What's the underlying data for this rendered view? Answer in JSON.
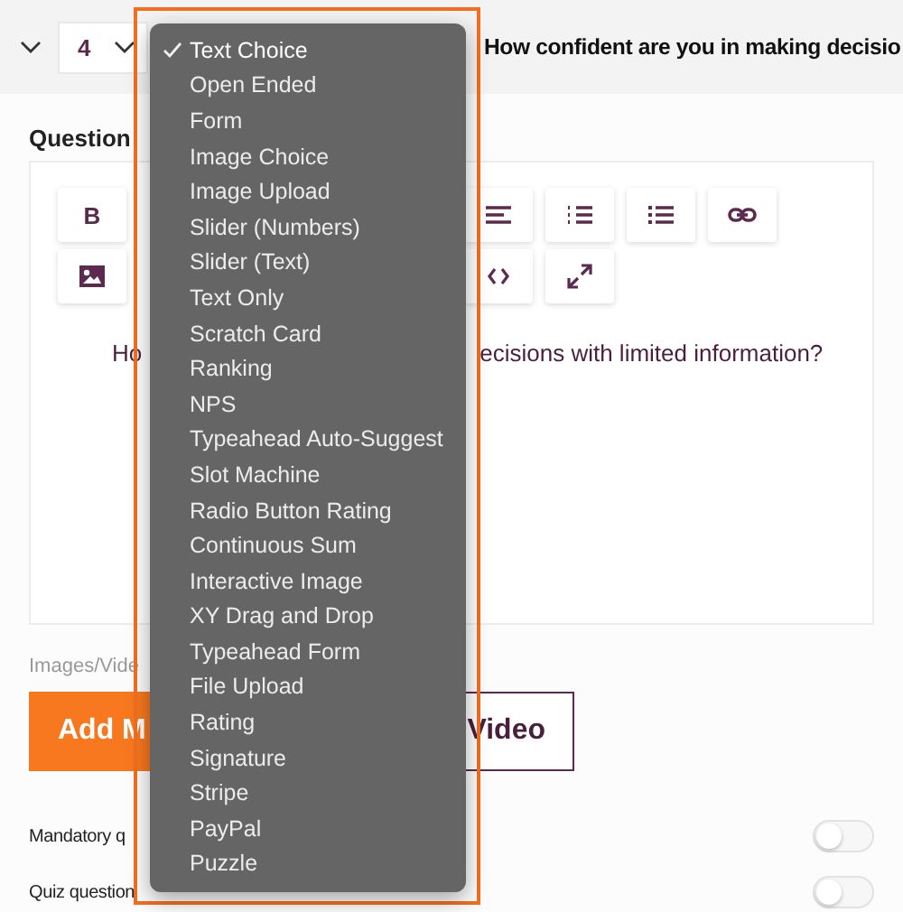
{
  "header": {
    "number": "4",
    "title": "How confident are you in making decisio"
  },
  "question": {
    "label": "Question",
    "toolbar": [
      [
        {
          "kind": "bold",
          "label": "B"
        },
        {
          "kind": "align-left"
        },
        {
          "kind": "ordered-list"
        },
        {
          "kind": "bullet-list"
        },
        {
          "kind": "link"
        }
      ],
      [
        {
          "kind": "image"
        },
        {
          "kind": "code"
        },
        {
          "kind": "expand"
        }
      ]
    ],
    "text_before": "Ho",
    "text_after": "ecisions with limited information?"
  },
  "media": {
    "label": "Images/Vide",
    "buttons": [
      {
        "kind": "primary",
        "label": "Add M"
      },
      {
        "kind": "outline",
        "label": "Video"
      }
    ]
  },
  "settings": [
    {
      "label": "Mandatory q",
      "on": false
    },
    {
      "label": "Quiz question",
      "on": false
    }
  ],
  "type_menu": {
    "items": [
      {
        "label": "Text Choice",
        "selected": true
      },
      {
        "label": "Open Ended",
        "selected": false
      },
      {
        "label": "Form",
        "selected": false
      },
      {
        "label": "Image Choice",
        "selected": false
      },
      {
        "label": "Image Upload",
        "selected": false
      },
      {
        "label": "Slider (Numbers)",
        "selected": false
      },
      {
        "label": "Slider (Text)",
        "selected": false
      },
      {
        "label": "Text Only",
        "selected": false
      },
      {
        "label": "Scratch Card",
        "selected": false
      },
      {
        "label": "Ranking",
        "selected": false
      },
      {
        "label": "NPS",
        "selected": false
      },
      {
        "label": "Typeahead Auto-Suggest",
        "selected": false
      },
      {
        "label": "Slot Machine",
        "selected": false
      },
      {
        "label": "Radio Button Rating",
        "selected": false
      },
      {
        "label": "Continuous Sum",
        "selected": false
      },
      {
        "label": "Interactive Image",
        "selected": false
      },
      {
        "label": "XY Drag and Drop",
        "selected": false
      },
      {
        "label": "Typeahead Form",
        "selected": false
      },
      {
        "label": "File Upload",
        "selected": false
      },
      {
        "label": "Rating",
        "selected": false
      },
      {
        "label": "Signature",
        "selected": false
      },
      {
        "label": "Stripe",
        "selected": false
      },
      {
        "label": "PayPal",
        "selected": false
      },
      {
        "label": "Puzzle",
        "selected": false
      }
    ]
  }
}
